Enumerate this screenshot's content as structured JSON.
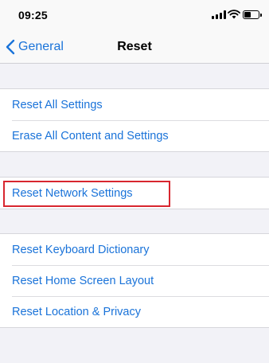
{
  "status_bar": {
    "time": "09:25",
    "icons": [
      "cellular-signal-icon",
      "wifi-icon",
      "battery-icon"
    ]
  },
  "nav": {
    "back_label": "General",
    "title": "Reset"
  },
  "groups": [
    {
      "items": [
        "Reset All Settings",
        "Erase All Content and Settings"
      ]
    },
    {
      "items": [
        "Reset Network Settings"
      ]
    },
    {
      "items": [
        "Reset Keyboard Dictionary",
        "Reset Home Screen Layout",
        "Reset Location & Privacy"
      ]
    }
  ],
  "colors": {
    "accent": "#1a73d9",
    "highlight_border": "#d8262f",
    "background": "#f2f2f7"
  }
}
